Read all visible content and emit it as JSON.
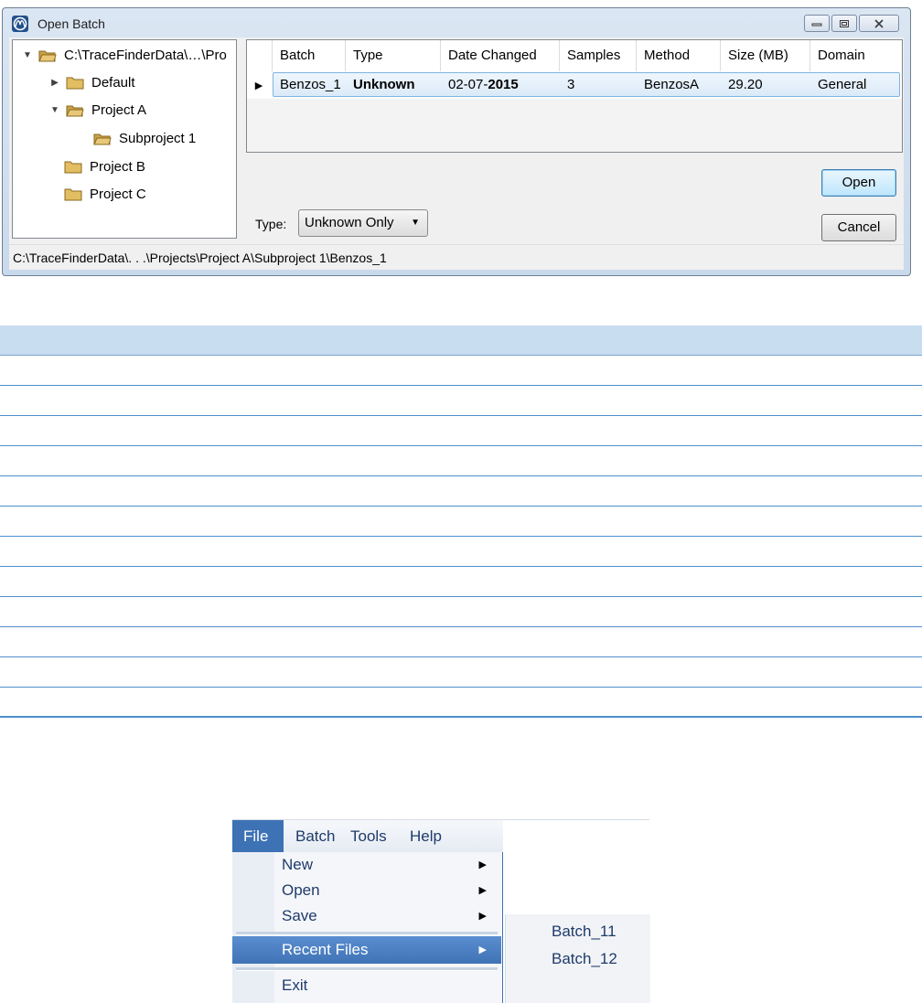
{
  "dialog": {
    "title": "Open Batch",
    "tree": {
      "root": "C:\\TraceFinderData\\…\\Pro",
      "items": [
        {
          "label": "Default",
          "expanded": false
        },
        {
          "label": "Project A",
          "expanded": true
        },
        {
          "label": "Subproject 1"
        },
        {
          "label": "Project B"
        },
        {
          "label": "Project C"
        }
      ]
    },
    "grid": {
      "columns": [
        "Batch",
        "Type",
        "Date Changed",
        "Samples",
        "Method",
        "Size (MB)",
        "Domain"
      ],
      "rows": [
        {
          "batch": "Benzos_1",
          "type": "Unknown",
          "date_prefix": "02-07-",
          "date_year": "2015",
          "samples": "3",
          "method": "BenzosA",
          "size": "29.20",
          "domain": "General"
        }
      ]
    },
    "type_filter": {
      "label": "Type:",
      "value": "Unknown Only"
    },
    "buttons": {
      "open": "Open",
      "cancel": "Cancel"
    },
    "status_path": "C:\\TraceFinderData\\. . .\\Projects\\Project A\\Subproject 1\\Benzos_1"
  },
  "menu": {
    "bar": [
      "File",
      "Batch",
      "Tools",
      "Help"
    ],
    "file_items": [
      "New",
      "Open",
      "Save",
      "Recent Files",
      "Exit"
    ],
    "recent_files": [
      "Batch_11",
      "Batch_12"
    ]
  },
  "colors": {
    "accent": "#3d72b4",
    "table_header": "#c9ddf1",
    "table_rule": "#4d8fcb"
  }
}
